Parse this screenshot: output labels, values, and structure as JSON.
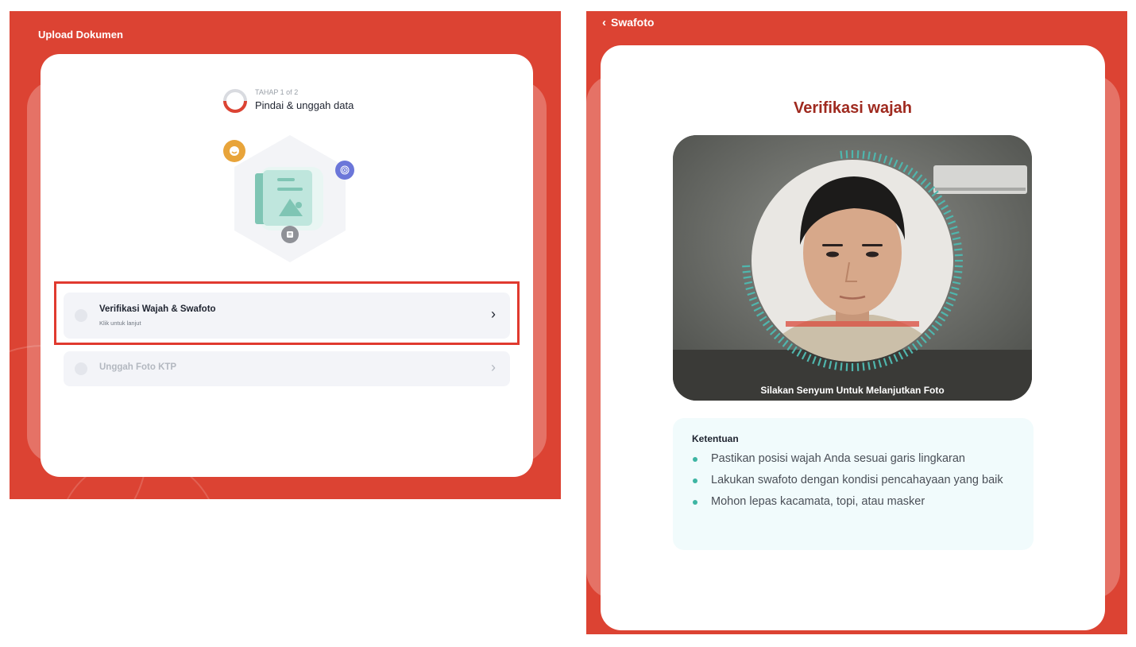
{
  "left_screen": {
    "header_title": "Upload Dokumen",
    "stage": {
      "label": "TAHAP 1 of 2",
      "title": "Pindai & unggah data",
      "progress": 0.5
    },
    "options": [
      {
        "title": "Verifikasi Wajah & Swafoto",
        "subtitle": "Klik untuk lanjut",
        "active": true
      },
      {
        "title": "Unggah Foto KTP",
        "active": false
      }
    ]
  },
  "right_screen": {
    "back_label": "Swafoto",
    "title": "Verifikasi wajah",
    "camera_caption": "Silakan Senyum Untuk Melanjutkan Foto",
    "rules_title": "Ketentuan",
    "rules": [
      "Pastikan posisi wajah Anda sesuai garis lingkaran",
      "Lakukan swafoto dengan kondisi pencahayaan yang baik",
      "Mohon lepas kacamata, topi, atau masker"
    ]
  },
  "colors": {
    "brand_red": "#dc4333",
    "title_red": "#9f2a1f",
    "teal": "#3db5a3",
    "highlight_red": "#e03a2f"
  },
  "icons": [
    "face-icon",
    "fingerprint-icon",
    "document-icon",
    "chevron-right-icon",
    "chevron-left-icon"
  ]
}
